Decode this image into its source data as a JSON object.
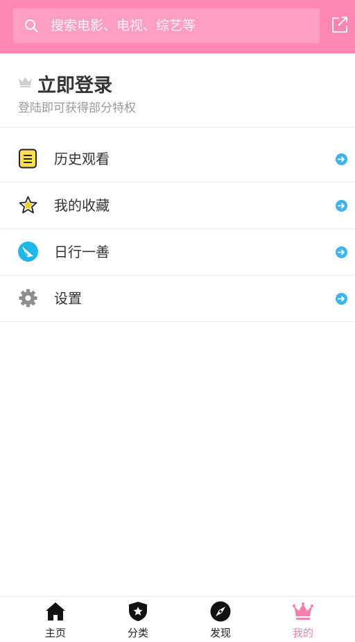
{
  "search": {
    "placeholder": "搜索电影、电视、综艺等",
    "icon": "search-icon",
    "share_icon": "share-icon"
  },
  "login": {
    "title": "立即登录",
    "subtitle": "登陆即可获得部分特权",
    "icon": "crown-icon"
  },
  "menu": {
    "items": [
      {
        "label": "历史观看",
        "icon": "history-list-icon"
      },
      {
        "label": "我的收藏",
        "icon": "star-icon"
      },
      {
        "label": "日行一善",
        "icon": "paper-plane-icon"
      },
      {
        "label": "设置",
        "icon": "gear-icon"
      }
    ]
  },
  "tabs": [
    {
      "label": "主页",
      "icon": "home-icon"
    },
    {
      "label": "分类",
      "icon": "shield-star-icon"
    },
    {
      "label": "发现",
      "icon": "compass-icon"
    },
    {
      "label": "我的",
      "icon": "crown-icon",
      "active": true
    }
  ],
  "colors": {
    "header": "#ff85b3",
    "search_bg": "#ff9ec3",
    "accent_arrow": "#3cb4ec",
    "active_tab": "#f67fb0"
  }
}
